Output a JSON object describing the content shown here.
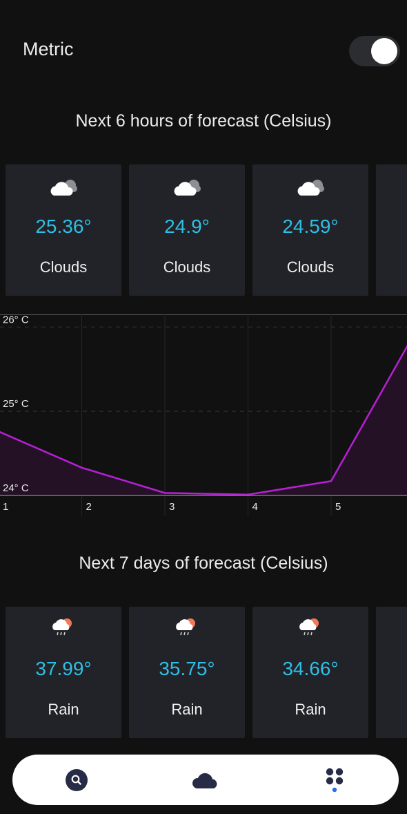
{
  "settings": {
    "metric_label": "Metric",
    "metric_enabled": true
  },
  "hourly": {
    "title": "Next 6 hours of forecast (Celsius)",
    "cards": [
      {
        "icon": "cloud-icon",
        "temp": "25.36°",
        "desc": "Clouds"
      },
      {
        "icon": "cloud-icon",
        "temp": "24.9°",
        "desc": "Clouds"
      },
      {
        "icon": "cloud-icon",
        "temp": "24.59°",
        "desc": "Clouds"
      }
    ]
  },
  "chart_data": {
    "type": "area",
    "x": [
      1,
      2,
      3,
      4,
      5,
      6
    ],
    "x_tick_labels": [
      "1",
      "2",
      "3",
      "4",
      "5"
    ],
    "series": [
      {
        "values": [
          24.76,
          24.33,
          24.03,
          24.01,
          24.17,
          25.92
        ]
      }
    ],
    "y_tick_labels": [
      "26° C",
      "25° C",
      "24° C"
    ],
    "y_ticks": [
      26,
      25,
      24
    ],
    "ylim": [
      24,
      26.15
    ],
    "grid": true,
    "line_color": "#b81fd6",
    "fill_color": "#241126"
  },
  "daily": {
    "title": "Next 7 days of forecast (Celsius)",
    "cards": [
      {
        "icon": "rain-sun-icon",
        "temp": "37.99°",
        "desc": "Rain"
      },
      {
        "icon": "rain-sun-icon",
        "temp": "35.75°",
        "desc": "Rain"
      },
      {
        "icon": "rain-sun-icon",
        "temp": "34.66°",
        "desc": "Rain"
      }
    ]
  },
  "nav": {
    "items": [
      {
        "icon": "search-icon"
      },
      {
        "icon": "cloud-icon"
      },
      {
        "icon": "apps-dots-icon"
      }
    ],
    "active_index": 2
  },
  "colors": {
    "accent_temp": "#2fbfe6",
    "card_bg": "#222328",
    "page_bg": "#111112",
    "nav_icon": "#272b45",
    "active_dot": "#1e6ff0"
  }
}
